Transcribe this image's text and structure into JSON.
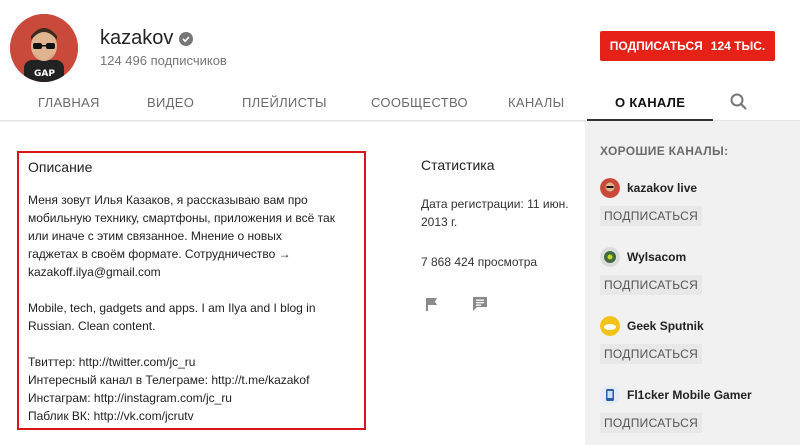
{
  "channel": {
    "name": "kazakov",
    "subscribers_text": "124 496 подписчиков"
  },
  "subscribe_button": {
    "label": "ПОДПИСАТЬСЯ",
    "count": "124 ТЫС."
  },
  "tabs": [
    {
      "label": "ГЛАВНАЯ"
    },
    {
      "label": "ВИДЕО"
    },
    {
      "label": "ПЛЕЙЛИСТЫ"
    },
    {
      "label": "СООБЩЕСТВО"
    },
    {
      "label": "КАНАЛЫ"
    },
    {
      "label": "О КАНАЛЕ",
      "active": true
    }
  ],
  "description": {
    "title": "Описание",
    "text": "Меня зовут Илья Казаков, я рассказываю вам про\nмобильную технику, смартфоны, приложения и всё так\nили иначе с этим связанное. Мнение о новых\nгаджетах в своём формате. Сотрудничество →\nkazakoff.ilya@gmail.com\n\nMobile, tech, gadgets and apps. I am Ilya and I blog in\nRussian. Clean content.\n\nТвиттер: http://twitter.com/jc_ru\nИнтересный канал в Телеграме: http://t.me/kazakof\nИнстаграм: http://instagram.com/jc_ru\nПаблик ВК: http://vk.com/jcrutv"
  },
  "stats": {
    "title": "Статистика",
    "registered": "Дата регистрации: 11 июн.\n2013 г.",
    "views": "7 868 424 просмотра"
  },
  "sidebar": {
    "title": "ХОРОШИЕ КАНАЛЫ:",
    "channels": [
      {
        "name": "kazakov live",
        "button": "ПОДПИСАТЬСЯ",
        "color": "#c94a3a"
      },
      {
        "name": "Wylsacom",
        "button": "ПОДПИСАТЬСЯ",
        "color": "#3f6b3f"
      },
      {
        "name": "Geek Sputnik",
        "button": "ПОДПИСАТЬСЯ",
        "color": "#f2c318"
      },
      {
        "name": "Fl1cker Mobile Gamer",
        "button": "ПОДПИСАТЬСЯ",
        "color": "#2a5ca8"
      }
    ]
  },
  "icons": {
    "verified": "verified-check-icon",
    "search": "search-icon",
    "flag": "flag-icon",
    "message": "message-icon"
  },
  "colors": {
    "accent": "#e62117",
    "highlight_border": "#d9141c"
  }
}
